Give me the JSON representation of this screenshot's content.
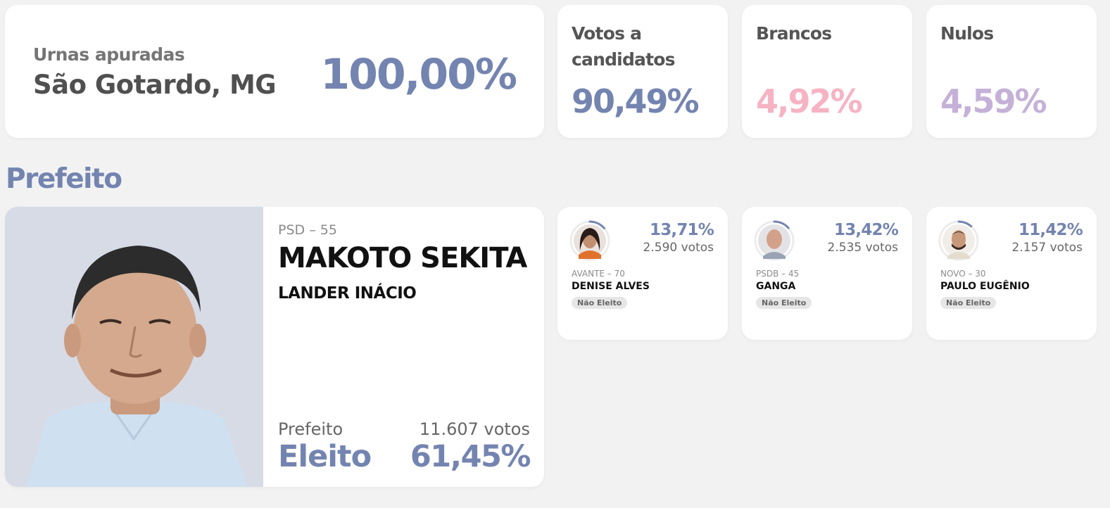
{
  "summary": {
    "label": "Urnas apuradas",
    "city": "São Gotardo, MG",
    "percent": "100,00%"
  },
  "stats": [
    {
      "title": "Votos a candidatos",
      "value": "90,49%",
      "color": "#7484b0"
    },
    {
      "title": "Brancos",
      "value": "4,92%",
      "color": "#f6b3c3"
    },
    {
      "title": "Nulos",
      "value": "4,59%",
      "color": "#c5b1d8"
    }
  ],
  "section_title": "Prefeito",
  "winner": {
    "party": "PSD – 55",
    "name": "MAKOTO SEKITA",
    "vice": "LANDER INÁCIO",
    "role": "Prefeito",
    "status": "Eleito",
    "votes": "11.607 votos",
    "percent": "61,45%",
    "photo_icon": "candidate-photo"
  },
  "candidates": [
    {
      "party": "AVANTE – 70",
      "name": "DENISE ALVES",
      "percent": "13,71%",
      "share": 0.1371,
      "votes": "2.590 votos",
      "status": "Não Eleito"
    },
    {
      "party": "PSDB – 45",
      "name": "GANGA",
      "percent": "13,42%",
      "share": 0.1342,
      "votes": "2.535 votos",
      "status": "Não Eleito"
    },
    {
      "party": "NOVO – 30",
      "name": "PAULO EUGÊNIO",
      "percent": "11,42%",
      "share": 0.1142,
      "votes": "2.157 votos",
      "status": "Não Eleito"
    }
  ],
  "colors": {
    "accent": "#7484b0",
    "brancos": "#f6b3c3",
    "nulos": "#c5b1d8"
  }
}
